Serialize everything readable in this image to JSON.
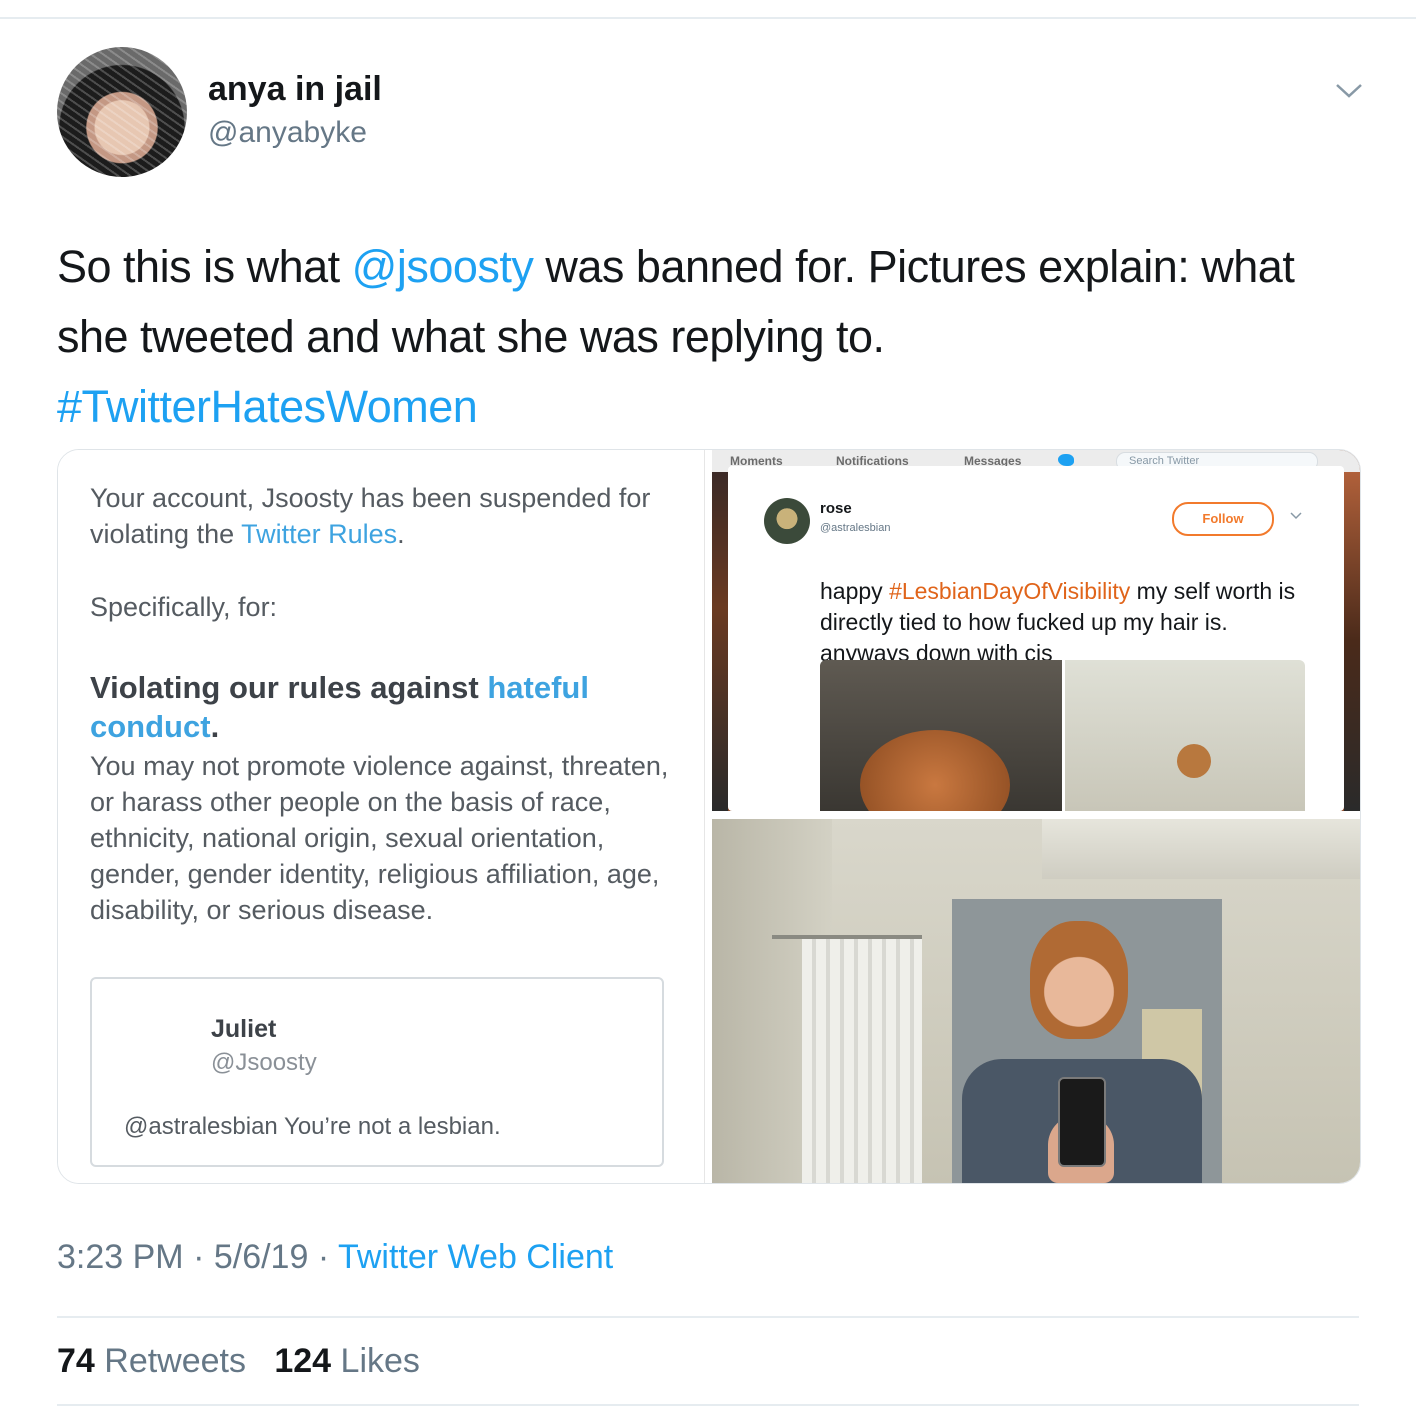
{
  "author": {
    "display_name": "anya in jail",
    "handle": "@anyabyke"
  },
  "tweet": {
    "text_part1": "So this is what ",
    "mention": "@jsoosty",
    "text_part2": " was banned for. Pictures explain: what she tweeted and what she was replying to.",
    "hashtag": "#TwitterHatesWomen"
  },
  "media": {
    "notice": {
      "line1_a": "Your account, Jsoosty has been suspended for violating the ",
      "line1_link": "Twitter Rules",
      "line1_b": ".",
      "specifically": "Specifically, for:",
      "heading_a": "Violating our rules against ",
      "heading_link": "hateful conduct",
      "heading_b": ".",
      "body": "You may not promote violence against, threaten, or harass other people on the basis of race, ethnicity, national origin, sexual orientation, gender, gender identity, religious affiliation, age, disability, or serious disease.",
      "quoted": {
        "name": "Juliet",
        "handle": "@Jsoosty",
        "text": "@astralesbian You’re not a lesbian."
      }
    },
    "rose_tweet": {
      "nav": {
        "moments": "Moments",
        "notifications": "Notifications",
        "messages": "Messages",
        "search_placeholder": "Search Twitter"
      },
      "name": "rose",
      "handle": "@astralesbian",
      "follow_label": "Follow",
      "text_a": "happy ",
      "hashtag": "#LesbianDayOfVisibility",
      "text_b": " my self worth is directly tied to how fucked up my hair is. anyways down with cis",
      "accent_color": "#e0641a"
    }
  },
  "meta": {
    "time": "3:23 PM",
    "sep1": " · ",
    "date": "5/6/19",
    "sep2": " · ",
    "client": "Twitter Web Client"
  },
  "stats": {
    "retweets_count": "74",
    "retweets_label": " Retweets",
    "likes_count": "124",
    "likes_label": " Likes"
  },
  "colors": {
    "link": "#1da1f2",
    "secondary_text": "#657786",
    "primary_text": "#14171a"
  },
  "icons": {
    "menu": "chevron-down-icon"
  }
}
